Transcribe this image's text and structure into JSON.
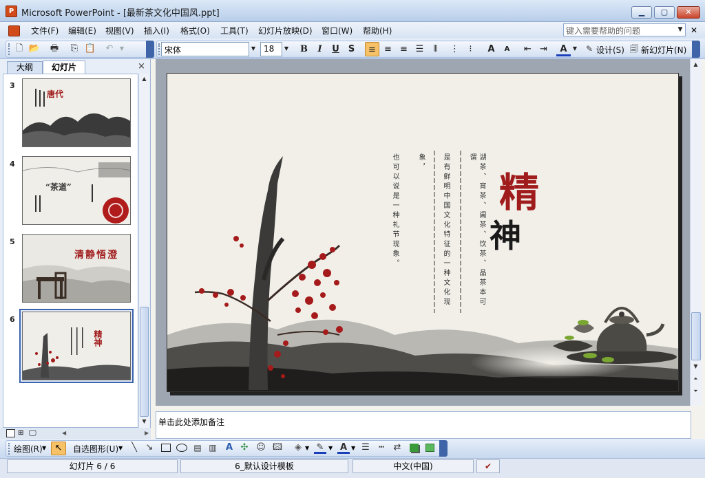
{
  "window": {
    "app_icon_letter": "P",
    "title": "Microsoft PowerPoint - [最新茶文化中国风.ppt]",
    "minimize": "▁",
    "maximize": "▢",
    "close": "✕"
  },
  "menubar": {
    "items": [
      "文件(F)",
      "编辑(E)",
      "视图(V)",
      "插入(I)",
      "格式(O)",
      "工具(T)",
      "幻灯片放映(D)",
      "窗口(W)",
      "帮助(H)"
    ],
    "help_placeholder": "键入需要帮助的问题"
  },
  "toolbar": {
    "font_name": "宋体",
    "font_size": "18",
    "bold": "B",
    "italic": "I",
    "underline": "U",
    "shadow": "S",
    "design_label": "设计(S)",
    "new_slide_label": "新幻灯片(N)",
    "accent_color": "#f6c167"
  },
  "left_pane": {
    "tabs": [
      "大纲",
      "幻灯片"
    ],
    "close": "×",
    "slides": [
      {
        "number": "3",
        "heading": "唐代",
        "selected": false
      },
      {
        "number": "4",
        "heading": "“茶道”",
        "selected": false
      },
      {
        "number": "5",
        "heading": "清静悟澄",
        "selected": false
      },
      {
        "number": "6",
        "heading": "精神",
        "selected": true
      }
    ]
  },
  "slide": {
    "title_char_1": "精",
    "title_char_2": "神",
    "title_color_1": "#a01c1c",
    "title_color_2": "#1a1a1a",
    "column_1": "湖茶、宵茶、阖茶、饮茶、品茶本可谓",
    "column_2": "是有鲜明中国文化特征的一种文化现",
    "column_3": "象，",
    "column_4": "也可以说是一种礼节现象。"
  },
  "notes": {
    "placeholder": "单击此处添加备注"
  },
  "drawbar": {
    "draw_label": "绘图(R)",
    "autoshapes_label": "自选图形(U)"
  },
  "statusbar": {
    "slide_position": "幻灯片 6 / 6",
    "template": "6_默认设计模板",
    "language": "中文(中国)"
  }
}
